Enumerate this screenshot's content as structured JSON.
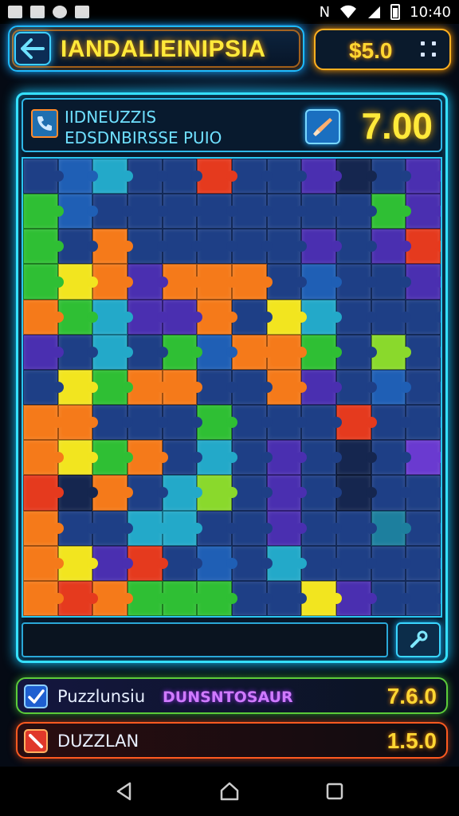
{
  "status_bar": {
    "time": "10:40",
    "icons": [
      "notification-icon",
      "image-icon",
      "app-icon",
      "cast-icon",
      "nfc-icon",
      "wifi-icon",
      "signal-icon",
      "battery-icon"
    ]
  },
  "header": {
    "title": "IANDALIEINIPSIA",
    "coins": "$5.0",
    "back_icon": "arrow-left-icon",
    "menu_icon": "grid-dots-icon"
  },
  "info": {
    "line1": "IIDNEUZZIS",
    "line2": "EDSDNBIRSSE PUIO",
    "score": "7.00",
    "left_icon": "phone-icon",
    "tool_icon": "brush-icon"
  },
  "board": {
    "colors": {
      "navy": "#1e3f86",
      "blue": "#1f5fb5",
      "cyan": "#23a9c9",
      "green": "#2fbf34",
      "lime": "#8ad92c",
      "yellow": "#f2e51f",
      "orange": "#f57a1a",
      "red": "#e53a1e",
      "purple": "#4a2fb0",
      "violet": "#6a3ad0",
      "teal": "#1d7f9e",
      "dark": "#15264f"
    },
    "rows": [
      [
        "navy",
        "blue",
        "cyan",
        "navy",
        "navy",
        "red",
        "navy",
        "navy",
        "purple",
        "dark",
        "navy",
        "purple"
      ],
      [
        "green",
        "blue",
        "navy",
        "navy",
        "navy",
        "navy",
        "navy",
        "navy",
        "navy",
        "navy",
        "green",
        "purple"
      ],
      [
        "green",
        "navy",
        "orange",
        "navy",
        "navy",
        "navy",
        "navy",
        "navy",
        "purple",
        "navy",
        "purple",
        "red"
      ],
      [
        "green",
        "yellow",
        "orange",
        "purple",
        "orange",
        "orange",
        "orange",
        "navy",
        "blue",
        "navy",
        "navy",
        "purple"
      ],
      [
        "orange",
        "green",
        "cyan",
        "purple",
        "purple",
        "orange",
        "navy",
        "yellow",
        "cyan",
        "navy",
        "navy",
        "navy"
      ],
      [
        "purple",
        "navy",
        "cyan",
        "navy",
        "green",
        "blue",
        "orange",
        "orange",
        "green",
        "navy",
        "lime",
        "navy"
      ],
      [
        "navy",
        "yellow",
        "green",
        "orange",
        "orange",
        "navy",
        "navy",
        "orange",
        "purple",
        "navy",
        "blue",
        "navy"
      ],
      [
        "orange",
        "orange",
        "navy",
        "navy",
        "navy",
        "green",
        "navy",
        "navy",
        "navy",
        "red",
        "navy",
        "navy"
      ],
      [
        "orange",
        "yellow",
        "green",
        "orange",
        "navy",
        "cyan",
        "navy",
        "purple",
        "navy",
        "dark",
        "navy",
        "violet"
      ],
      [
        "red",
        "dark",
        "orange",
        "navy",
        "cyan",
        "lime",
        "navy",
        "purple",
        "navy",
        "dark",
        "navy",
        "navy"
      ],
      [
        "orange",
        "navy",
        "navy",
        "cyan",
        "cyan",
        "navy",
        "navy",
        "purple",
        "navy",
        "navy",
        "teal",
        "navy"
      ],
      [
        "orange",
        "yellow",
        "purple",
        "red",
        "navy",
        "blue",
        "navy",
        "cyan",
        "navy",
        "navy",
        "navy",
        "navy"
      ],
      [
        "orange",
        "red",
        "orange",
        "green",
        "green",
        "green",
        "navy",
        "navy",
        "yellow",
        "purple",
        "navy",
        "navy"
      ]
    ],
    "tray_tool_icon": "wrench-icon"
  },
  "bottom_rows": [
    {
      "label": "Puzzlunsiu",
      "sub": "DUNSNTOSAUR",
      "value": "7.6.0",
      "icon": "check-icon"
    },
    {
      "label": "DUZZLAN",
      "sub": "",
      "value": "1.5.0",
      "icon": "slash-icon"
    }
  ],
  "nav": {
    "back": "back-triangle-icon",
    "home": "home-icon",
    "recents": "recents-square-icon"
  }
}
